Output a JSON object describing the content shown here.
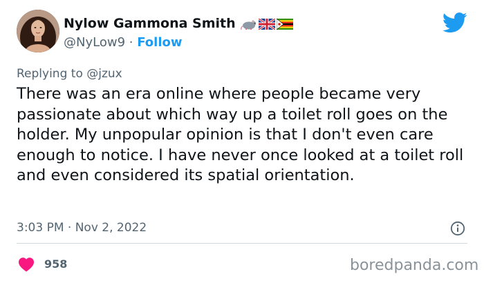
{
  "author": {
    "display_name": "Nylow Gammona Smith",
    "name_emoji": [
      "rat-emoji",
      "uk-flag-emoji",
      "zimbabwe-flag-emoji"
    ],
    "handle": "@NyLow9",
    "separator": "·",
    "follow_label": "Follow"
  },
  "reply": {
    "prefix": "Replying to",
    "mention": "@jzux"
  },
  "tweet": {
    "text": "There was an era online where people became very passionate about which way up a toilet roll goes on the holder. My unpopular opinion is that I don't even care enough to notice. I have never once looked at a toilet roll and even considered its spatial orientation.",
    "time": "3:03 PM",
    "separator": "·",
    "date": "Nov 2, 2022"
  },
  "engagement": {
    "likes": "958"
  },
  "watermark": "boredpanda.com",
  "colors": {
    "accent": "#1d9bf0",
    "heart": "#f91880",
    "secondary_text": "#536471",
    "primary_text": "#0f1419",
    "divider": "#cfd9de"
  },
  "icons": {
    "brand": "twitter-bird-icon",
    "info": "info-icon",
    "like": "heart-icon"
  }
}
